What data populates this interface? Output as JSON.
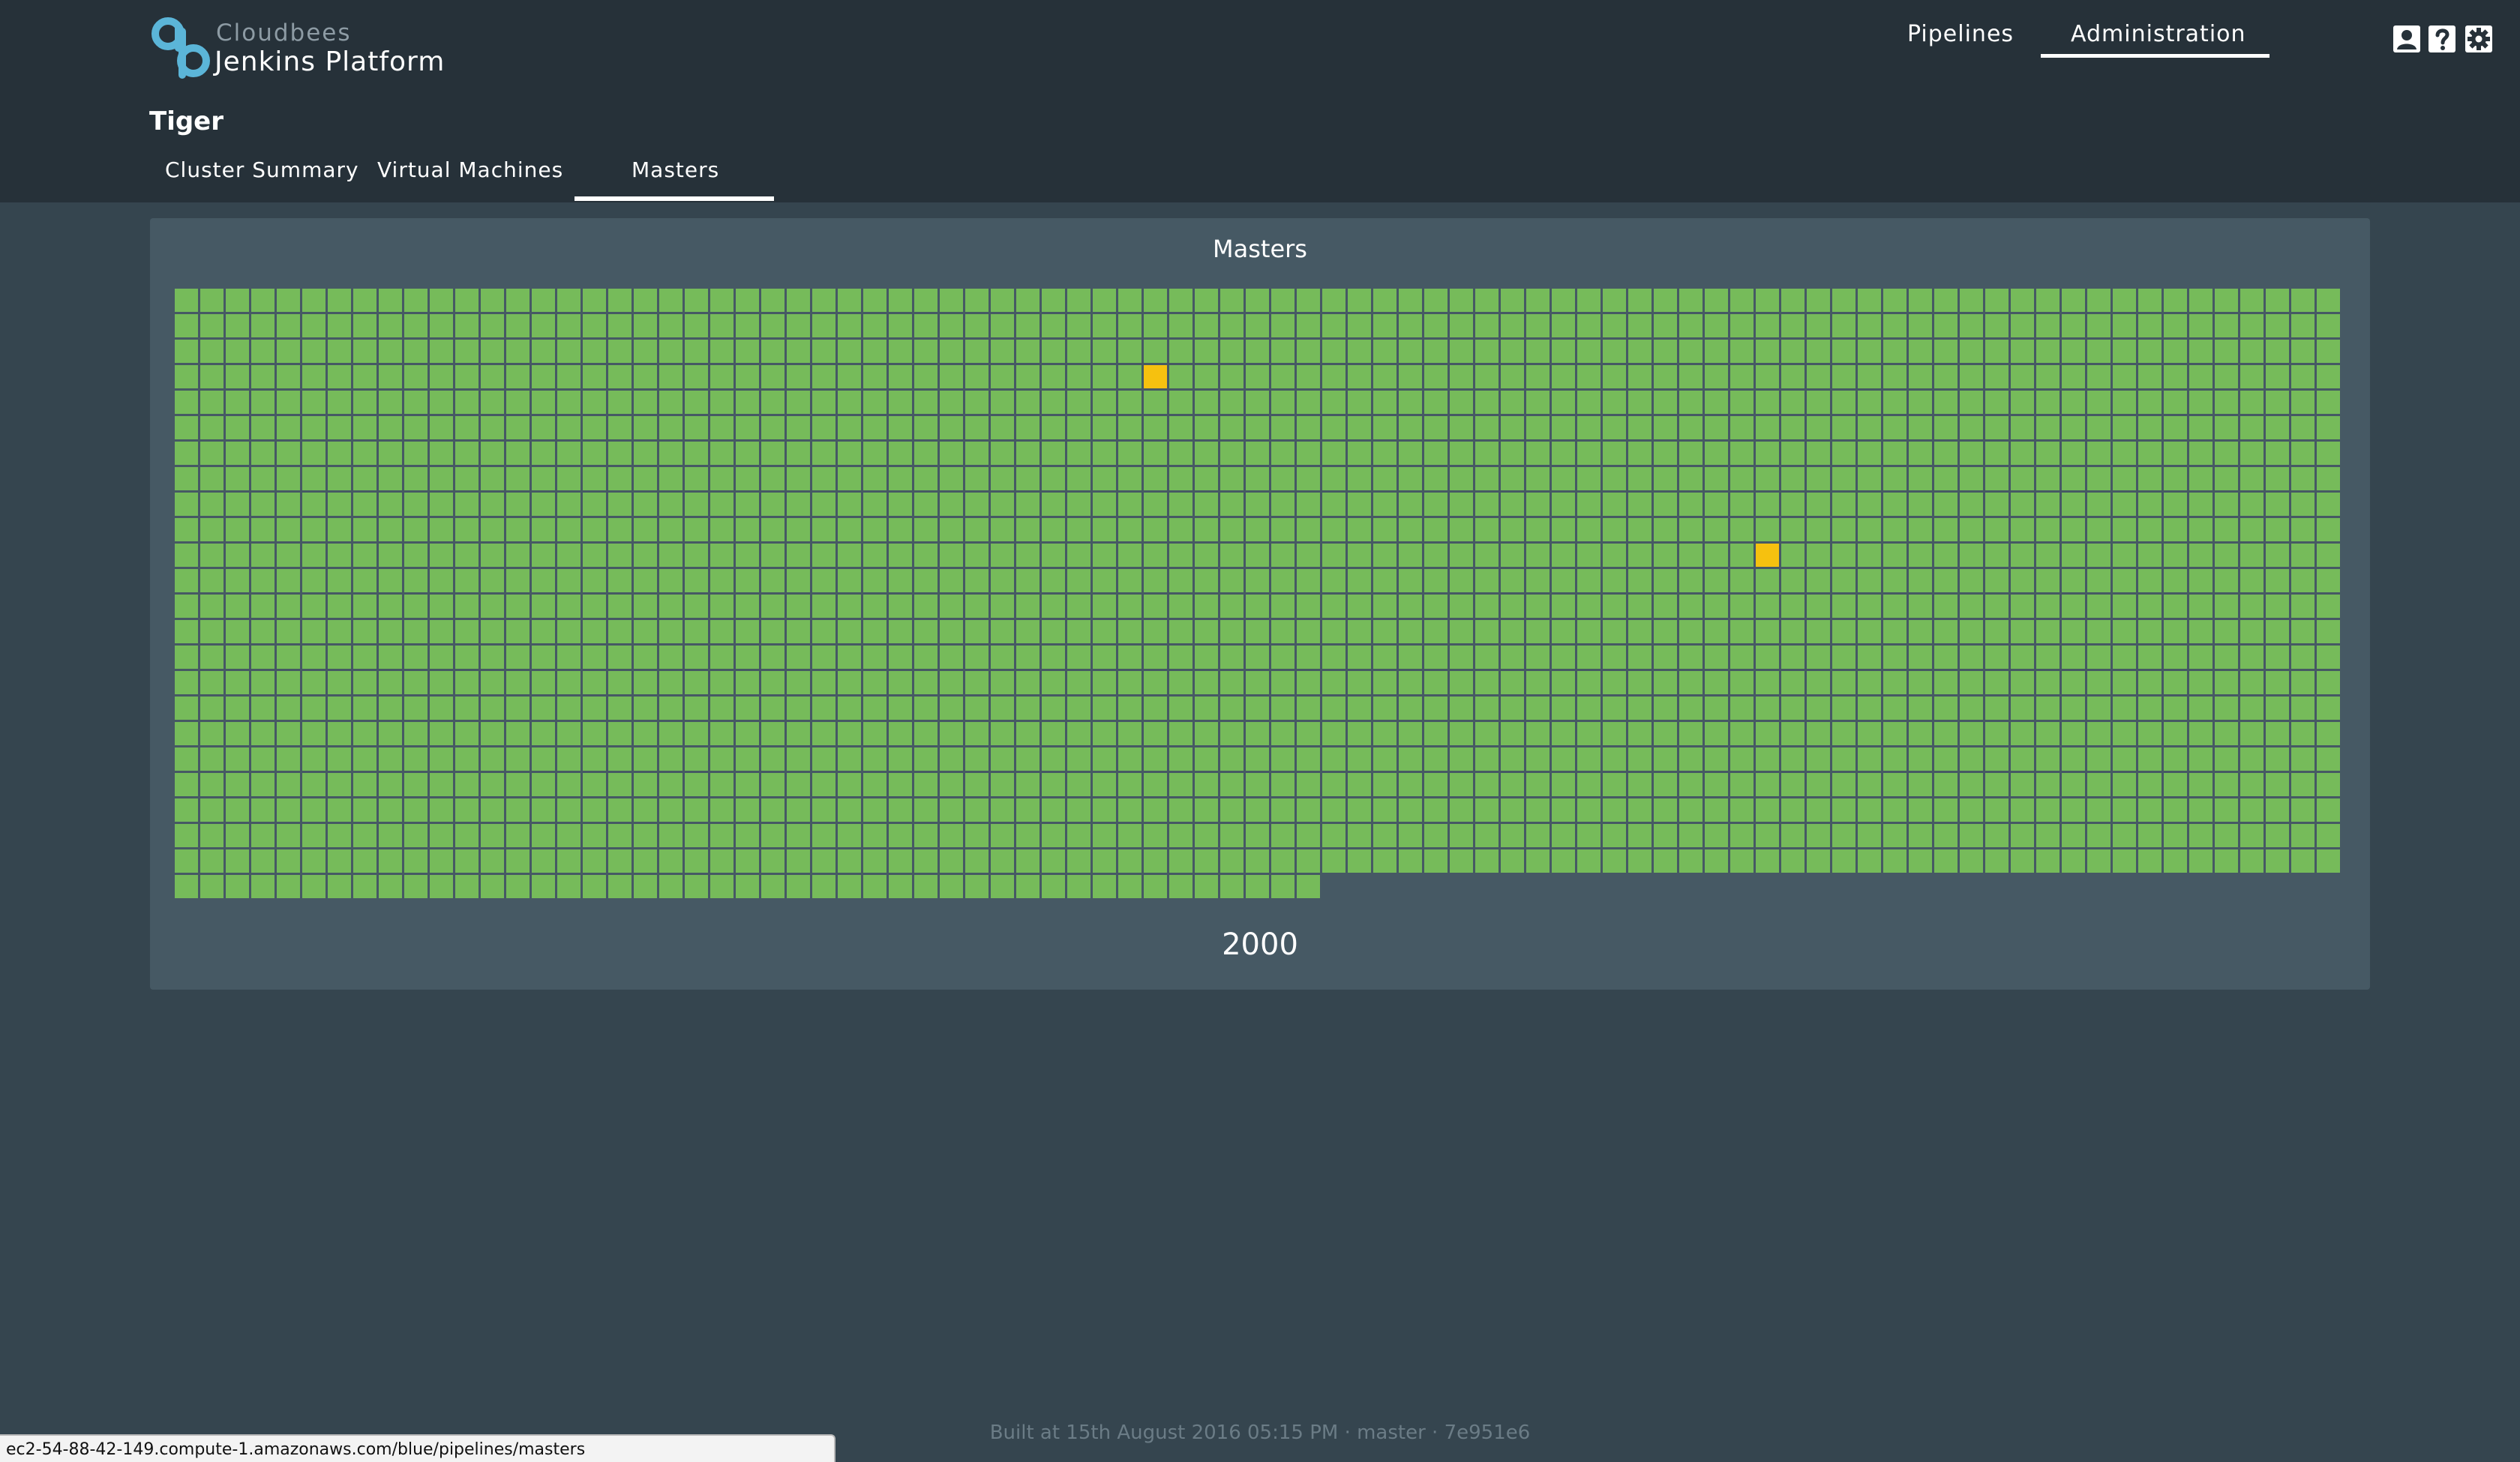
{
  "header": {
    "brand_small": "Cloudbees",
    "brand_name": "Jenkins Platform",
    "nav": [
      {
        "label": "Pipelines",
        "active": false
      },
      {
        "label": "Administration",
        "active": true
      }
    ],
    "icons": [
      "user-icon",
      "help-icon",
      "settings-icon"
    ]
  },
  "page": {
    "title": "Tiger",
    "tabs": [
      {
        "label": "Cluster Summary",
        "active": false
      },
      {
        "label": "Virtual Machines",
        "active": false
      },
      {
        "label": "Masters",
        "active": true
      }
    ]
  },
  "panel": {
    "title": "Masters",
    "count": "2000"
  },
  "grid": {
    "total": 2000,
    "columns": 85,
    "warning_cells": [
      {
        "row": 3,
        "col": 38
      },
      {
        "row": 10,
        "col": 62
      }
    ],
    "colors": {
      "ok": "#76bb5a",
      "warning": "#f6c10f",
      "gap": "#465964"
    }
  },
  "footer": {
    "text": "Built at 15th August 2016 05:15 PM · master · 7e951e6"
  },
  "status_bar": {
    "url": "ec2-54-88-42-149.compute-1.amazonaws.com/blue/pipelines/masters"
  },
  "colors": {
    "accent": "#5bb5d8",
    "header_bg": "#263139",
    "body_bg": "#35454f",
    "panel_bg": "#465964"
  }
}
